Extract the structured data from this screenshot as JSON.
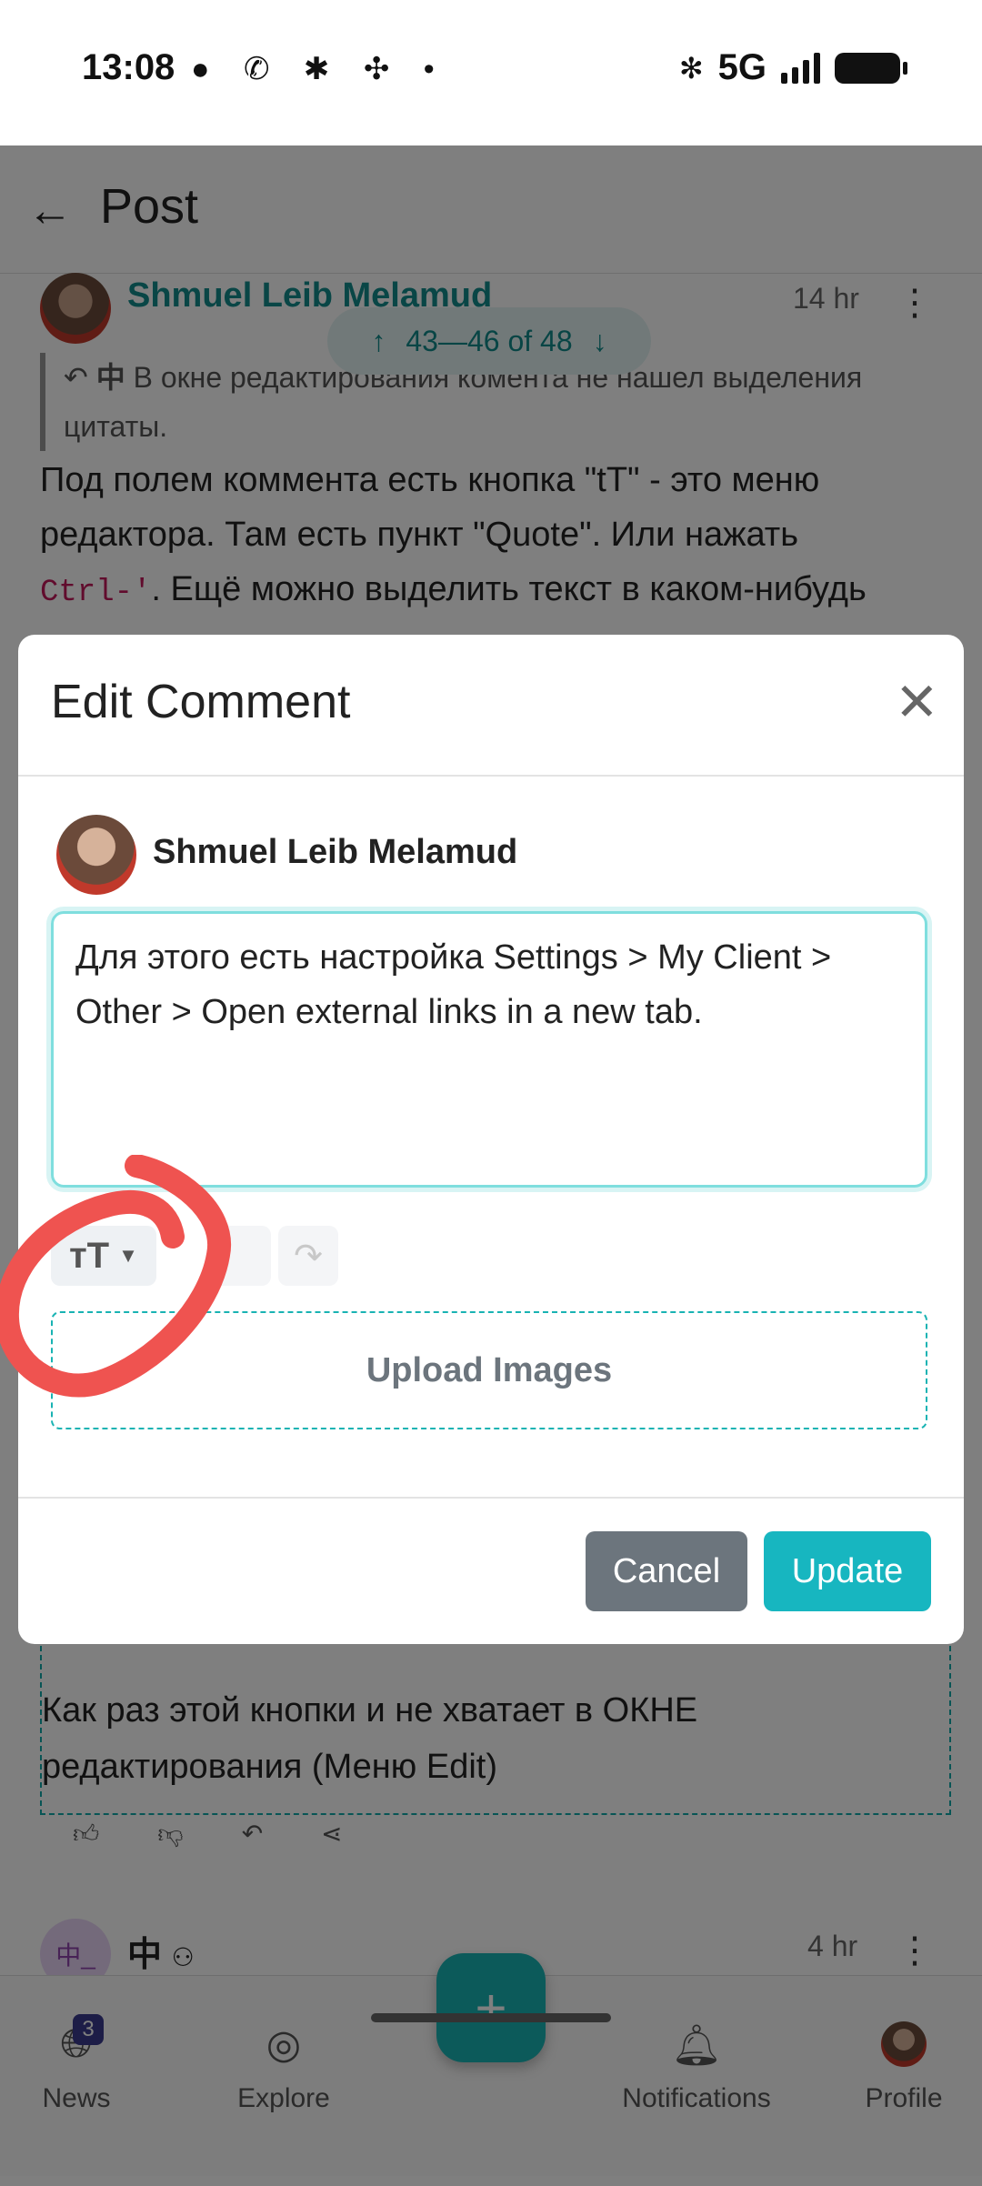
{
  "status_bar": {
    "time": "13:08",
    "network": "5G"
  },
  "app_bar": {
    "title": "Post"
  },
  "post": {
    "author": "Shmuel Leib Melamud",
    "time": "14 hr",
    "nav_counter": "43—46 of 48",
    "quote_author": "中",
    "quote_text": "В окне редактирования комента не нашел выделения цитаты.",
    "body_line1": "Под полем коммента есть кнопка \"tT\" - это меню",
    "body_line2": "редактора. Там есть пункт \"Quote\". Или нажать",
    "body_code": "Ctrl-'",
    "body_line3_rest": ". Ещё можно выделить текст в каком-нибудь"
  },
  "reply": {
    "text_line1": "Как раз этой кнопки и не хватает в ОКНЕ",
    "text_line2": "редактирования (Меню Edit)"
  },
  "next_comment": {
    "avatar_text": "中_",
    "author": "中",
    "time": "4 hr"
  },
  "bottom_nav": {
    "tabs": [
      {
        "label": "News",
        "icon": "globe-icon",
        "badge": "3"
      },
      {
        "label": "Explore",
        "icon": "compass-icon"
      },
      {
        "label": "Notifications",
        "icon": "bell-icon"
      },
      {
        "label": "Profile",
        "icon": "avatar"
      }
    ],
    "fab_label": "+"
  },
  "modal": {
    "title": "Edit Comment",
    "user_name": "Shmuel Leib Melamud",
    "textarea_value": "Для этого есть настройка Settings > My Client > Other > Open external links in a new tab.",
    "format_button": "тT",
    "upload_label": "Upload Images",
    "cancel_label": "Cancel",
    "update_label": "Update",
    "annotation_color": "#ef5350"
  }
}
